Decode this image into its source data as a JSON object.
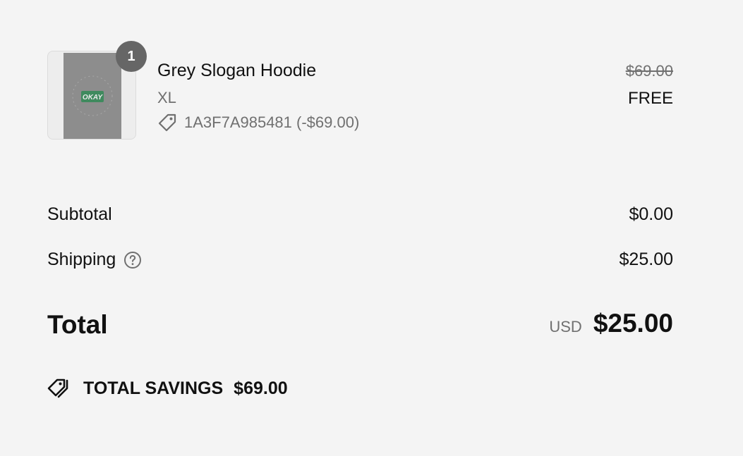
{
  "line_item": {
    "quantity": "1",
    "name": "Grey Slogan Hoodie",
    "variant": "XL",
    "discount_code": "1A3F7A985481 (-$69.00)",
    "original_price": "$69.00",
    "current_price": "FREE",
    "thumbnail": {
      "print_text": "OKAY",
      "garment_color": "#8d8d8d",
      "print_color": "#3f8a5e"
    }
  },
  "summary": {
    "subtotal_label": "Subtotal",
    "subtotal_value": "$0.00",
    "shipping_label": "Shipping",
    "shipping_value": "$25.00",
    "total_label": "Total",
    "total_currency": "USD",
    "total_value": "$25.00"
  },
  "savings": {
    "label": "TOTAL SAVINGS",
    "amount": "$69.00"
  },
  "icons": {
    "discount_tag": "tag-icon",
    "shipping_help": "question-circle-icon",
    "savings": "tags-icon"
  },
  "colors": {
    "background": "#f4f4f4",
    "text_primary": "#111111",
    "text_secondary": "#707070",
    "badge": "#666666"
  }
}
